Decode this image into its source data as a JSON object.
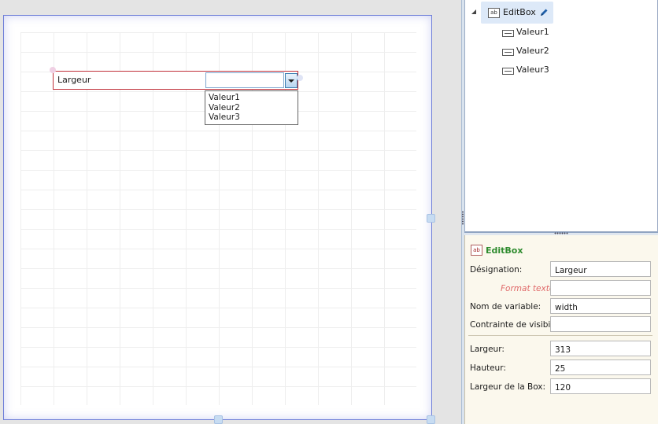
{
  "canvas": {
    "widget_label": "Largeur",
    "dropdown_options": [
      "Valeur1",
      "Valeur2",
      "Valeur3"
    ]
  },
  "tree": {
    "root": {
      "icon": "editbox-ab-icon",
      "label": "EditBox",
      "action_icon": "pencil-icon"
    },
    "children": [
      {
        "icon": "field-icon",
        "label": "Valeur1"
      },
      {
        "icon": "field-icon",
        "label": "Valeur2"
      },
      {
        "icon": "field-icon",
        "label": "Valeur3"
      }
    ]
  },
  "properties": {
    "title": "EditBox",
    "designation": {
      "label": "Désignation:",
      "value": "Largeur"
    },
    "format": {
      "label": "Format texte :",
      "value": ""
    },
    "variable": {
      "label": "Nom de variable:",
      "value": "width"
    },
    "visibility": {
      "label": "Contrainte de visibilité:",
      "value": ""
    },
    "width": {
      "label": "Largeur:",
      "value": "313"
    },
    "height": {
      "label": "Hauteur:",
      "value": "25"
    },
    "box_width": {
      "label": "Largeur de la Box:",
      "value": "120"
    }
  },
  "colors": {
    "selection_border": "#c0303a",
    "surface_border": "#6f7fd8",
    "props_title": "#2e8b2e",
    "props_background": "#fbf8ed"
  }
}
